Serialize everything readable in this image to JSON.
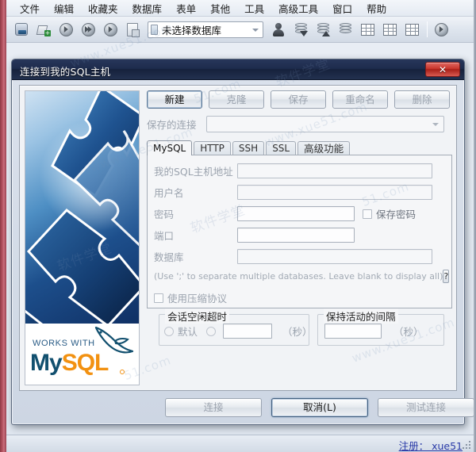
{
  "app": {
    "menu": [
      {
        "label": "文件",
        "name": "menu-file"
      },
      {
        "label": "编辑",
        "name": "menu-edit"
      },
      {
        "label": "收藏夹",
        "name": "menu-favorites"
      },
      {
        "label": "数据库",
        "name": "menu-database"
      },
      {
        "label": "表单",
        "name": "menu-table"
      },
      {
        "label": "其他",
        "name": "menu-other"
      },
      {
        "label": "工具",
        "name": "menu-tools"
      },
      {
        "label": "高级工具",
        "name": "menu-advanced-tools"
      },
      {
        "label": "窗口",
        "name": "menu-window"
      },
      {
        "label": "帮助",
        "name": "menu-help"
      }
    ],
    "toolbar": {
      "db_selector_value": "未选择数据库"
    },
    "statusbar": {
      "register_link": "注册： xue51"
    }
  },
  "dialog": {
    "title": "连接到我的SQL主机",
    "close_label": "✕",
    "top_buttons": [
      {
        "label": "新建",
        "name": "new-connection-button",
        "state": "default"
      },
      {
        "label": "克隆",
        "name": "clone-connection-button",
        "state": "disabled"
      },
      {
        "label": "保存",
        "name": "save-connection-button",
        "state": "disabled"
      },
      {
        "label": "重命名",
        "name": "rename-connection-button",
        "state": "disabled"
      },
      {
        "label": "删除",
        "name": "delete-connection-button",
        "state": "disabled"
      }
    ],
    "saved_connections": {
      "label": "保存的连接",
      "value": "",
      "placeholder": ""
    },
    "tabs": [
      {
        "label": "MySQL",
        "name": "tab-mysql",
        "active": true
      },
      {
        "label": "HTTP",
        "name": "tab-http",
        "active": false
      },
      {
        "label": "SSH",
        "name": "tab-ssh",
        "active": false
      },
      {
        "label": "SSL",
        "name": "tab-ssl",
        "active": false
      },
      {
        "label": "高级功能",
        "name": "tab-advanced",
        "active": false
      }
    ],
    "fields": {
      "host_label": "我的SQL主机地址",
      "host_value": "",
      "user_label": "用户名",
      "user_value": "",
      "password_label": "密码",
      "password_value": "",
      "save_password_label": "保存密码",
      "port_label": "端口",
      "port_value": "",
      "database_label": "数据库",
      "database_value": "",
      "database_hint": "(Use ';' to separate multiple databases. Leave blank to display all)",
      "help_button_label": "?"
    },
    "compression": {
      "label": "使用压缩协议"
    },
    "idle_timeout": {
      "legend": "会话空闲超时",
      "default_label": "默认",
      "value": "",
      "unit": "（秒）"
    },
    "keep_alive": {
      "legend": "保持活动的间隔",
      "value": "",
      "unit": "（秒）"
    },
    "bottom_buttons": [
      {
        "label": "连接",
        "name": "connect-button",
        "state": "disabled"
      },
      {
        "label": "取消(L)",
        "name": "cancel-button",
        "state": "focus"
      },
      {
        "label": "测试连接",
        "name": "test-connection-button",
        "state": "disabled"
      }
    ],
    "sidebar": {
      "works_with": "WORKS WITH",
      "brand_my": "My",
      "brand_sql": "SQL"
    }
  },
  "watermarks": [
    "www.xue51.com",
    "软件学堂",
    "51.com",
    "www.xue51.com",
    "软件学堂",
    "51.com"
  ],
  "colors": {
    "dialog_titlebar": "#1e2c4d",
    "close_button": "#c8352c",
    "accent_blue": "#2a3ba8",
    "mysql_blue": "#12506f",
    "mysql_orange": "#f29111",
    "panel_bg": "#f1f3f6",
    "disabled_text": "#9ba3ae"
  }
}
